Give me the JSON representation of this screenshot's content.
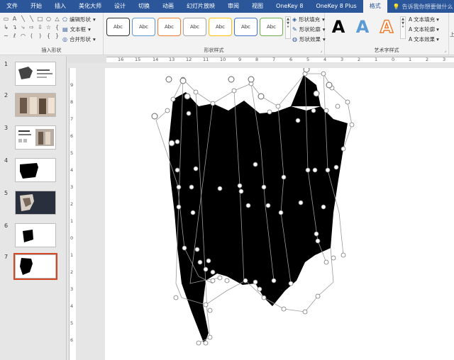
{
  "tabs": [
    "文件",
    "开始",
    "插入",
    "美化大师",
    "设计",
    "切换",
    "动画",
    "幻灯片放映",
    "审阅",
    "视图",
    "OneKey 8",
    "OneKey 8 Plus",
    "格式"
  ],
  "active_tab": "格式",
  "tell_me": "告诉我你想要做什么",
  "ribbon": {
    "insert_shapes": {
      "label": "插入形状",
      "edit_shape": "编辑形状",
      "text_box": "文本框",
      "merge_shapes": "合并形状"
    },
    "shape_styles": {
      "label": "形状样式",
      "styles": [
        "Abc",
        "Abc",
        "Abc",
        "Abc",
        "Abc",
        "Abc",
        "Abc"
      ],
      "fill": "形状填充",
      "outline": "形状轮廓",
      "effects": "形状效果"
    },
    "wordart": {
      "label": "艺术字样式",
      "samples": [
        "A",
        "A",
        "A"
      ],
      "text_fill": "文本填充",
      "text_outline": "文本轮廓",
      "text_effects": "文本效果"
    },
    "overflow_label": "上"
  },
  "slides": [
    {
      "num": "1"
    },
    {
      "num": "2"
    },
    {
      "num": "3"
    },
    {
      "num": "4"
    },
    {
      "num": "5"
    },
    {
      "num": "6"
    },
    {
      "num": "7"
    }
  ],
  "selected_slide": "7",
  "ruler_h": [
    "16",
    "15",
    "14",
    "13",
    "12",
    "11",
    "10",
    "9",
    "8",
    "7",
    "6",
    "5",
    "4",
    "3",
    "2",
    "1",
    "0",
    "1",
    "2",
    "3",
    "4",
    "5",
    "6",
    "7",
    "8"
  ],
  "ruler_v": [
    "9",
    "8",
    "7",
    "6",
    "5",
    "4",
    "3",
    "2",
    "1",
    "0",
    "1",
    "2",
    "3",
    "4",
    "5",
    "6",
    "7"
  ],
  "colors": {
    "ribbon_blue": "#2b579a",
    "selection_outline": "#d24726",
    "wordart_blue": "#5b9bd5",
    "wordart_orange": "#ed7d31"
  }
}
